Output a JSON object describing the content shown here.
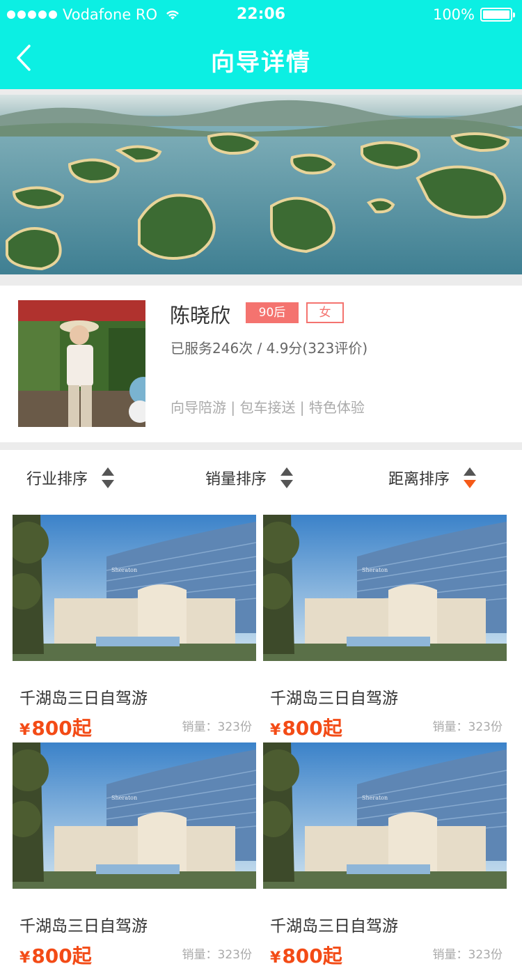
{
  "status_bar": {
    "carrier": "Vodafone RO",
    "time": "22:06",
    "battery": "100%",
    "battery_level": 1.0
  },
  "nav": {
    "title": "向导详情"
  },
  "guide": {
    "name": "陈晓欣",
    "age_tag": "90后",
    "gender_tag": "女",
    "stats": "已服务246次 / 4.9分(323评价)",
    "services": "向导陪游 | 包车接送 | 特色体验"
  },
  "sort": {
    "options": [
      "行业排序",
      "销量排序",
      "距离排序"
    ],
    "active_index": 2,
    "active_color": "#f55a18",
    "inactive_color": "#555555"
  },
  "colors": {
    "accent": "#0cefe3",
    "price": "#f34b16",
    "tag": "#f4736f"
  },
  "products": [
    {
      "title": "千湖岛三日自驾游",
      "price_symbol": "¥",
      "price": "800起",
      "sales": "销量：323份",
      "image_text": "Sheraton"
    },
    {
      "title": "千湖岛三日自驾游",
      "price_symbol": "¥",
      "price": "800起",
      "sales": "销量：323份",
      "image_text": "Sheraton"
    },
    {
      "title": "千湖岛三日自驾游",
      "price_symbol": "¥",
      "price": "800起",
      "sales": "销量：323份",
      "image_text": "Sheraton"
    },
    {
      "title": "千湖岛三日自驾游",
      "price_symbol": "¥",
      "price": "800起",
      "sales": "销量：323份",
      "image_text": "Sheraton"
    }
  ]
}
